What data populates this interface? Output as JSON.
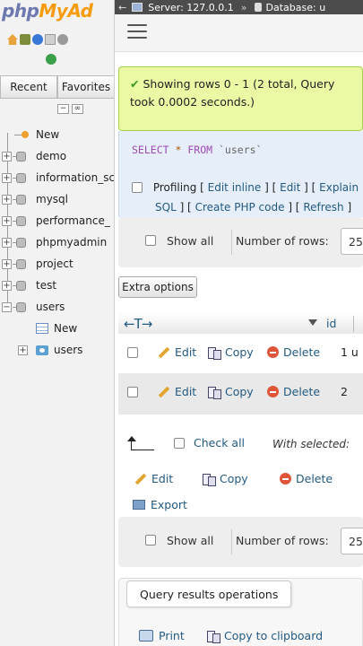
{
  "sidebar": {
    "logo_php": "php",
    "logo_rest": "MyAd",
    "tabs": [
      "Recent",
      "Favorites"
    ],
    "tree": [
      {
        "label": "New",
        "type": "new"
      },
      {
        "label": "demo",
        "type": "db"
      },
      {
        "label": "information_sc",
        "type": "db"
      },
      {
        "label": "mysql",
        "type": "db"
      },
      {
        "label": "performance_",
        "type": "db"
      },
      {
        "label": "phpmyadmin",
        "type": "db"
      },
      {
        "label": "project",
        "type": "db"
      },
      {
        "label": "test",
        "type": "db"
      },
      {
        "label": "users",
        "type": "db-open"
      }
    ],
    "subtree": [
      {
        "label": "New",
        "type": "new"
      },
      {
        "label": "users",
        "type": "table"
      }
    ]
  },
  "topbar": {
    "server": "Server: 127.0.0.1",
    "separator": "»",
    "database": "Database: u"
  },
  "result": {
    "message": "Showing rows 0 - 1 (2 total, Query took 0.0002 seconds.)",
    "sql_select": "SELECT",
    "sql_star": "*",
    "sql_from": "FROM",
    "sql_table": "`users`",
    "profiling": "Profiling",
    "links_line1": [
      "Edit inline",
      "Edit",
      "Explain"
    ],
    "links_line2": [
      "SQL",
      "Create PHP code",
      "Refresh"
    ]
  },
  "nav": {
    "show_all": "Show all",
    "number_of_rows": "Number of rows:",
    "rows_value": "25"
  },
  "extra_options": "Extra options",
  "table": {
    "arrows": "←T→",
    "column": "id",
    "rows": [
      {
        "id": "1 u"
      },
      {
        "id": "2"
      }
    ],
    "edit": "Edit",
    "copy": "Copy",
    "delete": "Delete"
  },
  "bulk": {
    "check_all": "Check all",
    "with_selected": "With selected:",
    "edit": "Edit",
    "copy": "Copy",
    "delete": "Delete",
    "export": "Export"
  },
  "query_ops": {
    "title": "Query results operations",
    "print": "Print",
    "copy_clipboard": "Copy to clipboard"
  }
}
